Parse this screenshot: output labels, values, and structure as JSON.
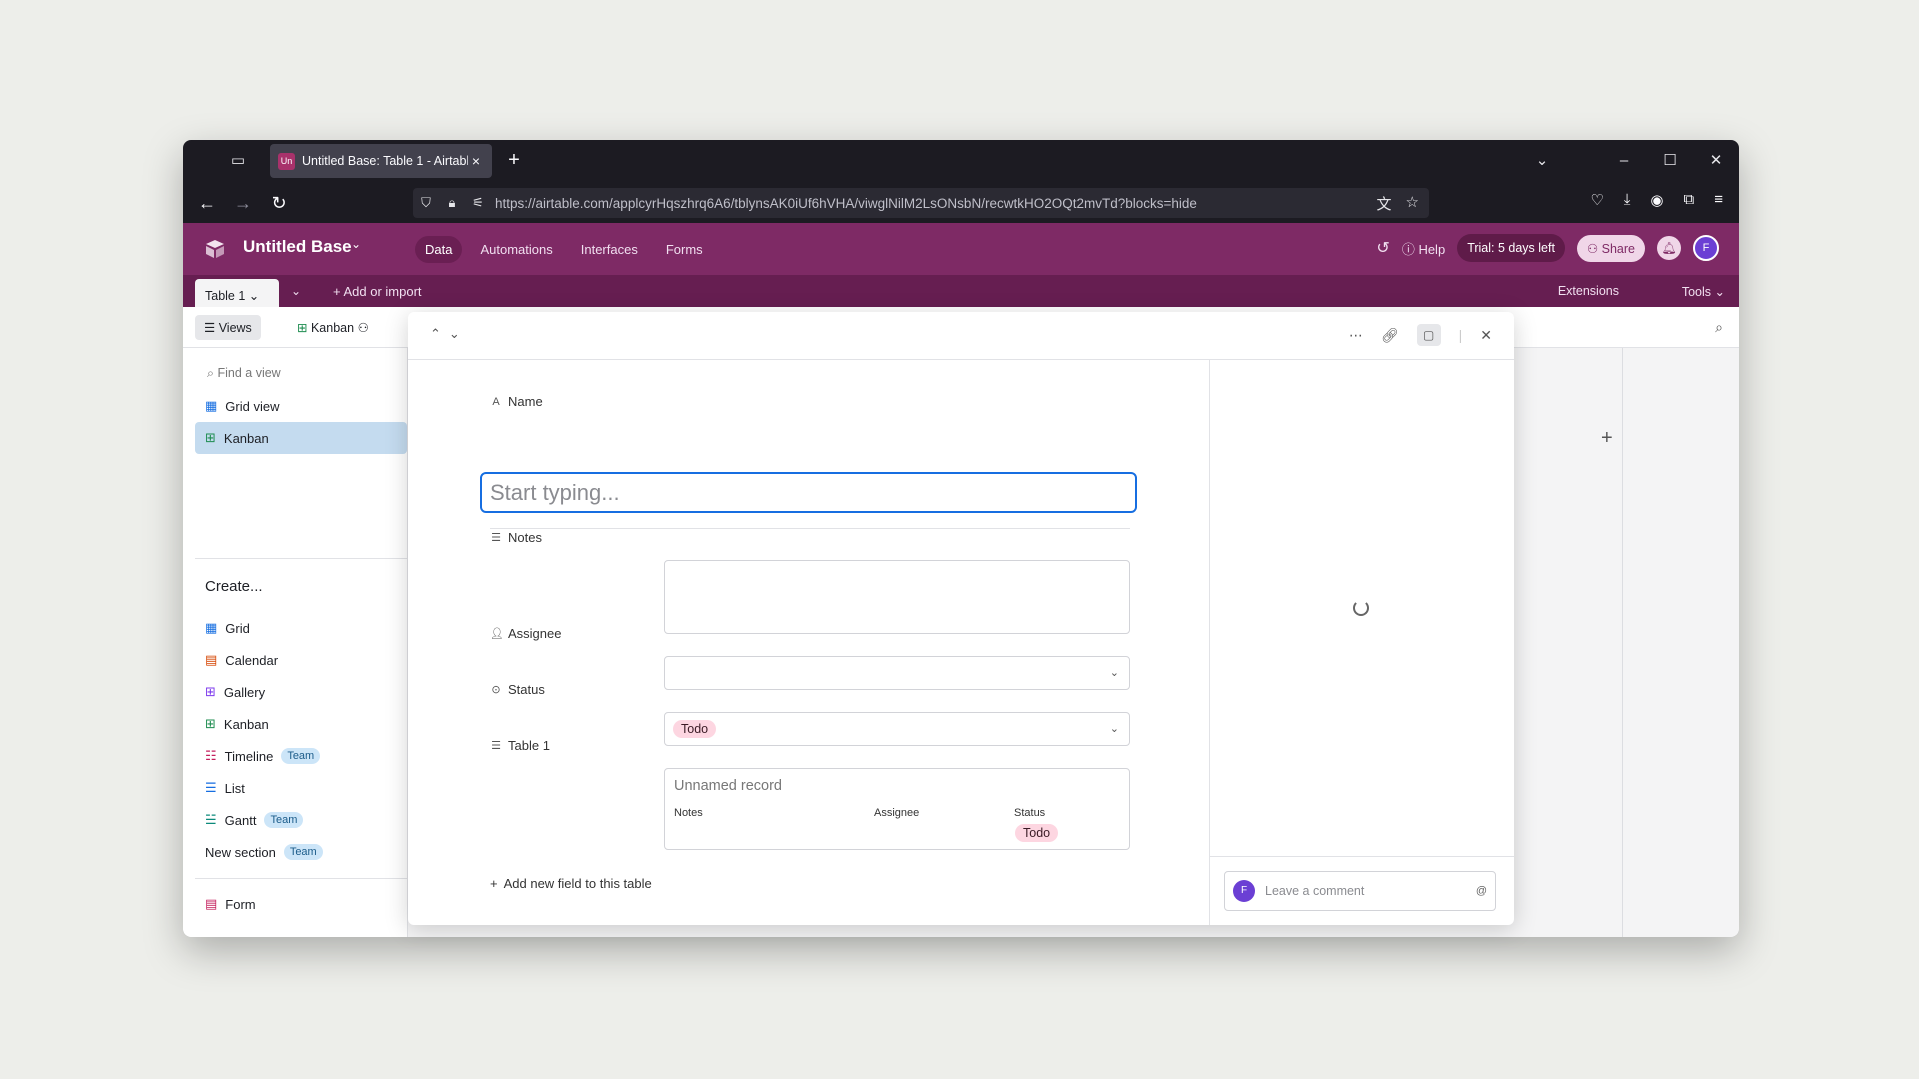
{
  "browser": {
    "tab_title": "Untitled Base: Table 1 - Airtable",
    "tab_favicon": "Un",
    "url": "https://airtable.com/applcyrHqszhrq6A6/tblynsAK0iUf6hVHA/viwglNilM2LsONsbN/recwtkHO2OQt2mvTd?blocks=hide"
  },
  "header": {
    "base_name": "Untitled Base",
    "nav": [
      "Data",
      "Automations",
      "Interfaces",
      "Forms"
    ],
    "help": "Help",
    "trial": "Trial: 5 days left",
    "share": "Share",
    "avatar": "F"
  },
  "tablebar": {
    "table": "Table 1",
    "add_import": "Add or import",
    "extensions": "Extensions",
    "tools": "Tools"
  },
  "viewbar": {
    "views": "Views",
    "current_view": "Kanban"
  },
  "sidebar": {
    "find_placeholder": "Find a view",
    "views": [
      "Grid view",
      "Kanban"
    ],
    "create_label": "Create...",
    "create_items": [
      "Grid",
      "Calendar",
      "Gallery",
      "Kanban",
      "Timeline",
      "List",
      "Gantt",
      "New section",
      "Form"
    ],
    "team_badge": "Team"
  },
  "modal": {
    "name_label": "Name",
    "name_placeholder": "Start typing...",
    "notes_label": "Notes",
    "assignee_label": "Assignee",
    "status_label": "Status",
    "status_value": "Todo",
    "table_label": "Table 1",
    "linked_title": "Unnamed record",
    "linked_cols": [
      "Notes",
      "Assignee",
      "Status"
    ],
    "linked_status": "Todo",
    "add_field": "Add new field to this table",
    "comment_placeholder": "Leave a comment",
    "comment_avatar": "F"
  },
  "colors": {
    "header": "#7e2a65",
    "accent": "#166ee1",
    "pill": "#fdd6e1"
  }
}
